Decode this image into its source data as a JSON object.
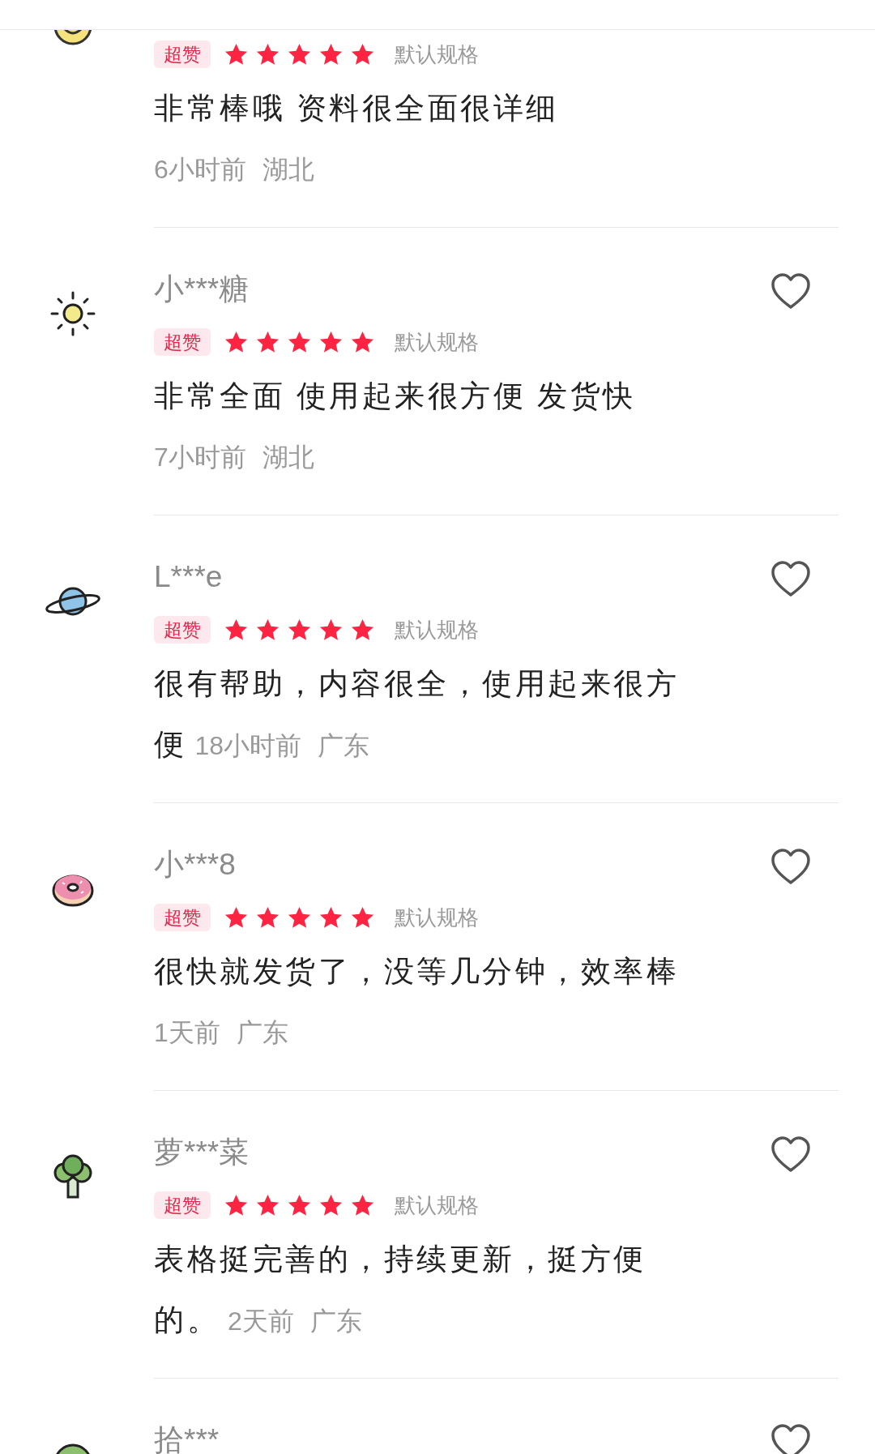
{
  "reviews": [
    {
      "badge": "超赞",
      "stars": 5,
      "spec": "默认规格",
      "content": "非常棒哦 资料很全面很详细",
      "time": "6小时前",
      "region": "湖北"
    },
    {
      "name": "小***糖",
      "badge": "超赞",
      "stars": 5,
      "spec": "默认规格",
      "content": "非常全面 使用起来很方便 发货快",
      "time": "7小时前",
      "region": "湖北"
    },
    {
      "name": "L***e",
      "badge": "超赞",
      "stars": 5,
      "spec": "默认规格",
      "content": "很有帮助，内容很全，使用起来很方便",
      "time": "18小时前",
      "region": "广东"
    },
    {
      "name": "小***8",
      "badge": "超赞",
      "stars": 5,
      "spec": "默认规格",
      "content": "很快就发货了，没等几分钟，效率棒",
      "time": "1天前",
      "region": "广东"
    },
    {
      "name": "萝***菜",
      "badge": "超赞",
      "stars": 5,
      "spec": "默认规格",
      "content": "表格挺完善的，持续更新，挺方便的。",
      "time": "2天前",
      "region": "广东"
    },
    {
      "name": "拾***"
    }
  ]
}
